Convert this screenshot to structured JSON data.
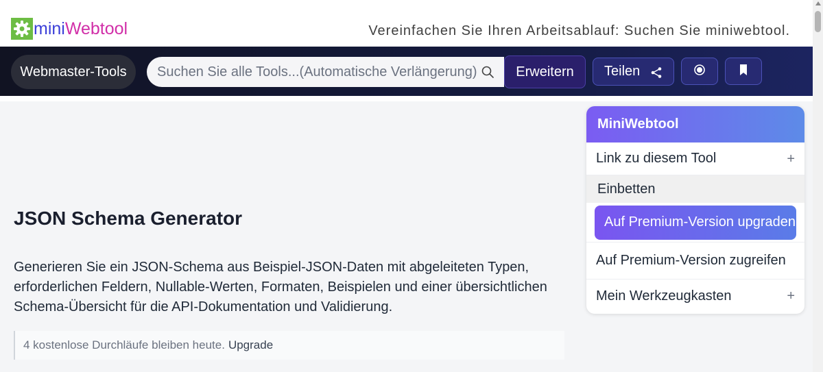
{
  "header": {
    "logo_mini": "mini",
    "logo_web": "Webtool",
    "tagline": "Vereinfachen Sie Ihren Arbeitsablauf: Suchen Sie miniwebtool."
  },
  "nav": {
    "category_label": "Webmaster-Tools",
    "search_placeholder": "Suchen Sie alle Tools...(Automatische Verlängerung)",
    "expand_label": "Erweitern",
    "share_label": "Teilen"
  },
  "main": {
    "title": "JSON Schema Generator",
    "description": "Generieren Sie ein JSON-Schema aus Beispiel-JSON-Daten mit abgeleiteten Typen, erforderlichen Feldern, Nullable-Werten, Formaten, Beispielen und einer übersichtlichen Schema-Übersicht für die API-Dokumentation und Validierung.",
    "runs_text": "4 kostenlose Durchläufe bleiben heute.",
    "runs_upgrade": "Upgrade"
  },
  "sidebar_card": {
    "title": "MiniWebtool",
    "link_label": "Link zu diesem Tool",
    "embed_label": "Einbetten",
    "premium_upgrade_label": "Auf Premium-Version upgraden",
    "premium_access_label": "Auf Premium-Version zugreifen",
    "toolbox_label": "Mein Werkzeugkasten",
    "plus": "+"
  },
  "colors": {
    "nav_bg": "#141a3e",
    "accent_purple": "#7b5cf2",
    "logo_green": "#6dbd44",
    "logo_blue": "#3b3fd8",
    "logo_pink": "#d12fa8"
  }
}
